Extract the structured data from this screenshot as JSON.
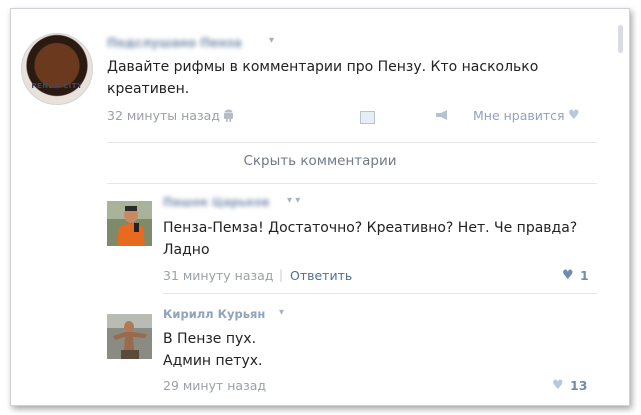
{
  "post": {
    "avatar_text": "PENZA CITY",
    "author": "Подслушано Пенза",
    "text_line1": "Давайте рифмы в комментарии про Пензу. Кто насколько",
    "text_line2": "креативен.",
    "time": "32 минуты назад",
    "like_label": "Мне нравится"
  },
  "hide_comments": "Скрыть комментарии",
  "comments": [
    {
      "author": "Пашок Царьков",
      "text_line1": "Пенза-Пемза! Достаточно? Креативно? Нет. Че правда?",
      "text_line2": "Ладно",
      "time": "31 минуту назад",
      "separator": "|",
      "reply_label": "Ответить",
      "likes": "1"
    },
    {
      "author": "Кирилл Курьян",
      "text_line1": "В Пензе пух.",
      "text_line2": "Админ петух.",
      "time": "29 минут назад",
      "likes": "13"
    }
  ],
  "icons": {
    "caret": "▾",
    "android": "android-icon",
    "share": "share-icon",
    "megaphone": "megaphone-icon",
    "heart": "heart-icon"
  },
  "colors": {
    "link": "#4f6e96",
    "author": "#8fa3bd",
    "meta": "#9aa0a8",
    "heart": "#b8c8da"
  }
}
